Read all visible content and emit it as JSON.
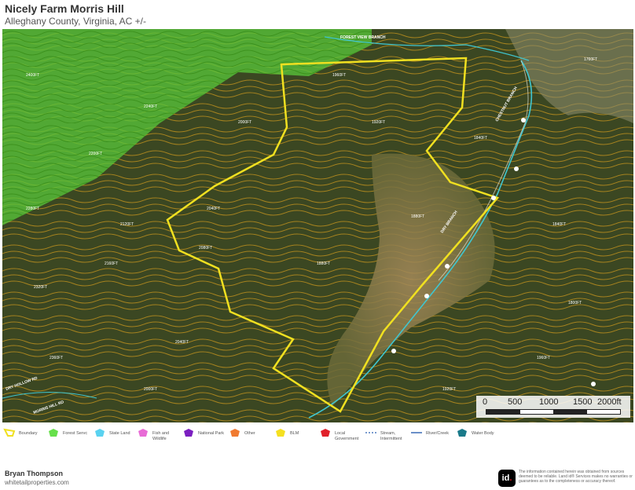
{
  "title": "Nicely Farm Morris Hill",
  "subtitle": "Alleghany County, Virginia,  AC +/-",
  "scale": {
    "labels": [
      "0",
      "500",
      "1000",
      "1500",
      "2000ft"
    ]
  },
  "legend": [
    {
      "label": "Boundary",
      "color": "#f0e020"
    },
    {
      "label": "Forest Servc",
      "color": "#66e04a"
    },
    {
      "label": "State Land",
      "color": "#5ad2f0"
    },
    {
      "label": "Fish and Wildlife",
      "color": "#e86bd6"
    },
    {
      "label": "National Park",
      "color": "#7b1fc0"
    },
    {
      "label": "Other",
      "color": "#f07a30"
    },
    {
      "label": "BLM",
      "color": "#f5e020"
    },
    {
      "label": "Local Government",
      "color": "#e0202a"
    },
    {
      "label": "Stream, Intermittent",
      "color": "#2a5fb0"
    },
    {
      "label": "River/Creek",
      "color": "#2a5fb0"
    },
    {
      "label": "Water Body",
      "color": "#1a7a8a"
    }
  ],
  "contour_labels": [
    "1960FT",
    "2000FT",
    "2040FT",
    "2080FT",
    "2120FT",
    "2160FT",
    "2200FT",
    "2240FT",
    "2280FT",
    "2320FT",
    "2360FT",
    "2400FT",
    "1920FT",
    "1880FT",
    "1840FT",
    "1800FT",
    "1760FT"
  ],
  "map_labels": {
    "road1": "FOREST VIEW BRANCH",
    "road2": "CHESTNUT BRANCH",
    "road3": "DRY BRANCH",
    "road4": "DRY HOLLOW RD",
    "road5": "MORRIS HILL RD"
  },
  "footer": {
    "name": "Bryan Thompson",
    "url": "whitetailproperties.com",
    "logo": "id",
    "disclaimer": "The information contained herein was obtained from sources deemed to be reliable. Land id® Services makes no warranties or guarantees as to the completeness or accuracy thereof."
  }
}
